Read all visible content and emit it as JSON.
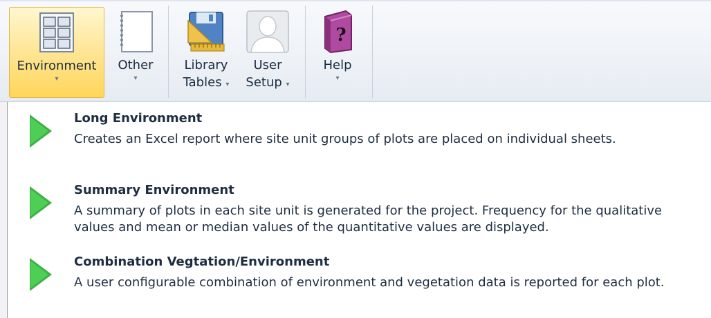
{
  "ribbon": {
    "buttons": [
      {
        "line1": "Environment",
        "line2": "",
        "icon": "grid-report-icon"
      },
      {
        "line1": "Other",
        "line2": "",
        "icon": "notebook-icon"
      },
      {
        "line1": "Library",
        "line2": "Tables",
        "icon": "floppy-ruler-icon"
      },
      {
        "line1": "User",
        "line2": "Setup",
        "icon": "user-silhouette-icon"
      },
      {
        "line1": "Help",
        "line2": "",
        "icon": "help-book-icon"
      }
    ],
    "active": "Environment",
    "dropdown_glyph": "▾"
  },
  "menu": {
    "items": [
      {
        "title": "Long Environment",
        "desc": "Creates an Excel report where site unit groups of plots are placed on individual sheets."
      },
      {
        "title": "Summary Environment",
        "desc": "A summary of plots in each site unit is generated for the project.  Frequency for the qualitative values and mean or median values of the quantitative values are displayed."
      },
      {
        "title": "Combination Vegtation/Environment",
        "desc": "A user configurable combination of environment and vegetation data is reported for each plot."
      }
    ],
    "item_icon": "green-play-arrow-icon"
  },
  "colors": {
    "active_button": "#ffd65a",
    "arrow_green": "#3cb043"
  }
}
